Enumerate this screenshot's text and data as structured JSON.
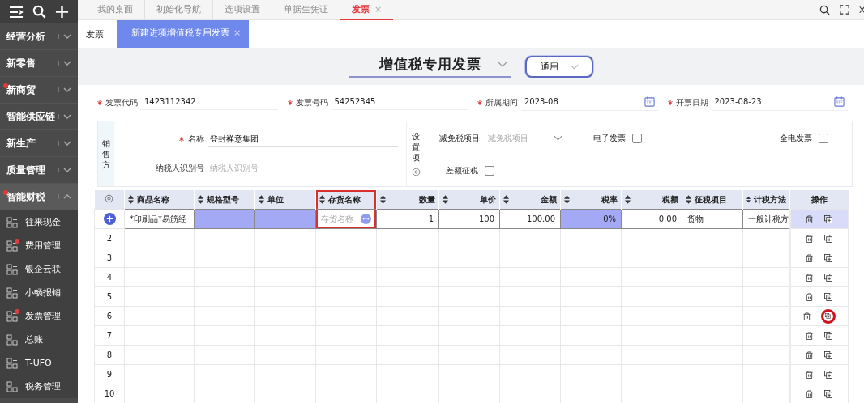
{
  "sidebar": {
    "groups": [
      {
        "label": "经营分析",
        "expanded": false,
        "dot": false
      },
      {
        "label": "新零售",
        "expanded": false,
        "dot": false
      },
      {
        "label": "新商贸",
        "expanded": false,
        "dot": true
      },
      {
        "label": "智能供应链",
        "expanded": false,
        "dot": false
      },
      {
        "label": "新生产",
        "expanded": false,
        "dot": false
      },
      {
        "label": "质量管理",
        "expanded": false,
        "dot": false
      },
      {
        "label": "智能财税",
        "expanded": true,
        "dot": true,
        "children": [
          {
            "label": "往来现金",
            "dot": false
          },
          {
            "label": "费用管理",
            "dot": true
          },
          {
            "label": "银企云联",
            "dot": false
          },
          {
            "label": "小畅报销",
            "dot": false
          },
          {
            "label": "发票管理",
            "dot": true
          },
          {
            "label": "总账",
            "dot": false
          },
          {
            "label": "T-UFO",
            "dot": false
          },
          {
            "label": "税务管理",
            "dot": false
          }
        ]
      }
    ]
  },
  "tabs": [
    {
      "label": "我的桌面",
      "selected": false
    },
    {
      "label": "初始化导航",
      "selected": false
    },
    {
      "label": "选项设置",
      "selected": false
    },
    {
      "label": "单据生凭证",
      "selected": false
    },
    {
      "label": "发票",
      "selected": true,
      "close": "×"
    }
  ],
  "subtabs": [
    {
      "label": "发票",
      "selected": false
    },
    {
      "label": "新建进项增值税专用发票",
      "selected": true,
      "close": "×"
    }
  ],
  "header": {
    "title": "增值税专用发票",
    "template": "通用"
  },
  "fields": [
    {
      "label": "发票代码",
      "required": true,
      "value": "1423112342",
      "kind": "text"
    },
    {
      "label": "发票号码",
      "required": true,
      "value": "54252345",
      "kind": "text"
    },
    {
      "label": "所属期间",
      "required": true,
      "value": "2023-08",
      "kind": "date"
    },
    {
      "label": "开票日期",
      "required": true,
      "value": "2023-08-23",
      "kind": "date"
    }
  ],
  "seller": {
    "label": "销售方",
    "fields": [
      {
        "label": "名称",
        "required": true,
        "value": "登封禅意集团"
      },
      {
        "label": "纳税人识别号",
        "placeholder": "纳税人识别号"
      }
    ]
  },
  "settings": {
    "label": "设置项",
    "items": [
      {
        "kind": "select",
        "label": "减免税项目",
        "placeholder": "减免税项目"
      },
      {
        "kind": "checkbox",
        "label": "电子发票",
        "checked": false
      },
      {
        "kind": "checkbox",
        "label": "全电发票",
        "checked": false
      },
      {
        "kind": "checkbox",
        "label": "差额征税",
        "checked": false
      }
    ]
  },
  "table": {
    "columns": [
      {
        "label": "商品名称",
        "kind": "text",
        "boxed": false
      },
      {
        "label": "规格型号",
        "kind": "text",
        "boxed": false
      },
      {
        "label": "单位",
        "kind": "text",
        "boxed": false
      },
      {
        "label": "存货名称",
        "kind": "text",
        "boxed": true
      },
      {
        "label": "数量",
        "kind": "number",
        "boxed": false
      },
      {
        "label": "单价",
        "kind": "number",
        "boxed": false
      },
      {
        "label": "金额",
        "kind": "number",
        "boxed": false
      },
      {
        "label": "税率",
        "kind": "number",
        "boxed": false
      },
      {
        "label": "税额",
        "kind": "number",
        "boxed": false
      },
      {
        "label": "征税项目",
        "kind": "text",
        "boxed": false
      },
      {
        "label": "计税方法",
        "kind": "text",
        "boxed": false
      }
    ],
    "actions_label": "操作",
    "rows": [
      {
        "kind": "entry",
        "selected": true,
        "circled": false,
        "cells": [
          {
            "text": "*印刷品*易筋经",
            "highlighted": false
          },
          {
            "highlighted": true
          },
          {
            "highlighted": true
          },
          {
            "kind": "lookup",
            "placeholder": "存货名称",
            "highlighted": false
          },
          {
            "text": "1",
            "highlighted": false
          },
          {
            "text": "100",
            "highlighted": false
          },
          {
            "text": "100.00",
            "highlighted": false
          },
          {
            "text": "0%",
            "highlighted": true
          },
          {
            "text": "0.00",
            "highlighted": false
          },
          {
            "text": "货物",
            "highlighted": false
          },
          {
            "text": "一般计税方",
            "highlighted": false
          }
        ]
      },
      {
        "kind": "blank",
        "index": "2",
        "selected": false,
        "circled": false
      },
      {
        "kind": "blank",
        "index": "3",
        "selected": false,
        "circled": false
      },
      {
        "kind": "blank",
        "index": "4",
        "selected": false,
        "circled": false
      },
      {
        "kind": "blank",
        "index": "5",
        "selected": false,
        "circled": false
      },
      {
        "kind": "blank",
        "index": "6",
        "selected": false,
        "circled": true
      },
      {
        "kind": "blank",
        "index": "7",
        "selected": false,
        "circled": false
      },
      {
        "kind": "blank",
        "index": "8",
        "selected": false,
        "circled": false
      },
      {
        "kind": "blank",
        "index": "9",
        "selected": false,
        "circled": false
      },
      {
        "kind": "blank",
        "index": "10",
        "selected": false,
        "circled": false
      }
    ]
  }
}
